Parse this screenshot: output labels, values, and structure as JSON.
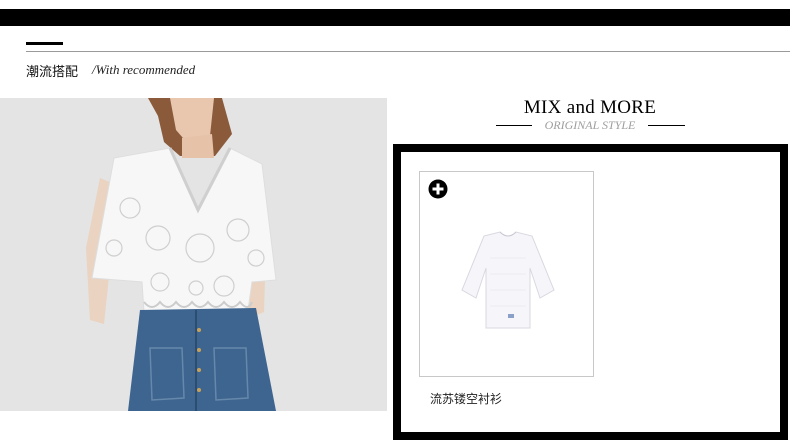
{
  "section": {
    "title": "潮流搭配",
    "subtitle": "/With recommended"
  },
  "mix": {
    "title": "MIX and MORE",
    "subtitle": "ORIGINAL STYLE"
  },
  "product": {
    "name": "流苏镂空衬衫",
    "add_icon": "plus-circle-icon"
  },
  "colors": {
    "bar": "#000000",
    "photo_bg": "#e3e3e3",
    "denim": "#3e6590",
    "subtitle_gray": "#9e9e9e"
  }
}
